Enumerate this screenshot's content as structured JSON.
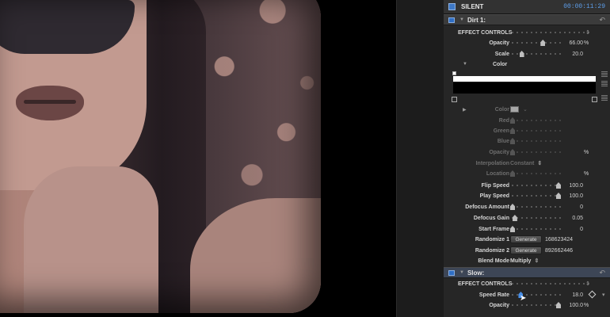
{
  "header": {
    "title": "SILENT",
    "timecode": "00:00:11:29"
  },
  "effects": [
    {
      "name": "Dirt 1:",
      "section_label": "EFFECT CONTROLS",
      "reset_icon": "reset-icon"
    },
    {
      "name": "Slow:",
      "section_label": "EFFECT CONTROLS",
      "reset_icon": "reset-icon"
    }
  ],
  "dirt": {
    "opacity": {
      "label": "Opacity",
      "value": "66.00",
      "unit": "%",
      "level": 0.66
    },
    "scale": {
      "label": "Scale",
      "value": "20.0",
      "level": 0.2
    },
    "color_group": {
      "label": "Color"
    },
    "color": {
      "label": "Color"
    },
    "red": {
      "label": "Red"
    },
    "green": {
      "label": "Green"
    },
    "blue": {
      "label": "Blue"
    },
    "opacity2": {
      "label": "Opacity",
      "unit": "%"
    },
    "interpolation": {
      "label": "Interpolation",
      "value": "Constant"
    },
    "location": {
      "label": "Location",
      "unit": "%"
    },
    "flip_speed": {
      "label": "Flip Speed",
      "value": "100.0",
      "level": 1.0
    },
    "play_speed": {
      "label": "Play Speed",
      "value": "100.0",
      "level": 1.0
    },
    "defocus_amount": {
      "label": "Defocus Amount",
      "value": "0",
      "level": 0.0
    },
    "defocus_gain": {
      "label": "Defocus Gain",
      "value": "0.05",
      "level": 0.05
    },
    "start_frame": {
      "label": "Start Frame",
      "value": "0",
      "level": 0.0
    },
    "randomize1": {
      "label": "Randomize 1",
      "button": "Generate",
      "value": "168623424"
    },
    "randomize2": {
      "label": "Randomize 2",
      "button": "Generate",
      "value": "892662446"
    },
    "blend_mode": {
      "label": "Blend Mode",
      "value": "Multiply"
    }
  },
  "slow": {
    "speed_rate": {
      "label": "Speed Rate",
      "value": "18.0",
      "level": 0.18
    },
    "opacity": {
      "label": "Opacity",
      "value": "100.0",
      "unit": "%",
      "level": 1.0
    }
  }
}
